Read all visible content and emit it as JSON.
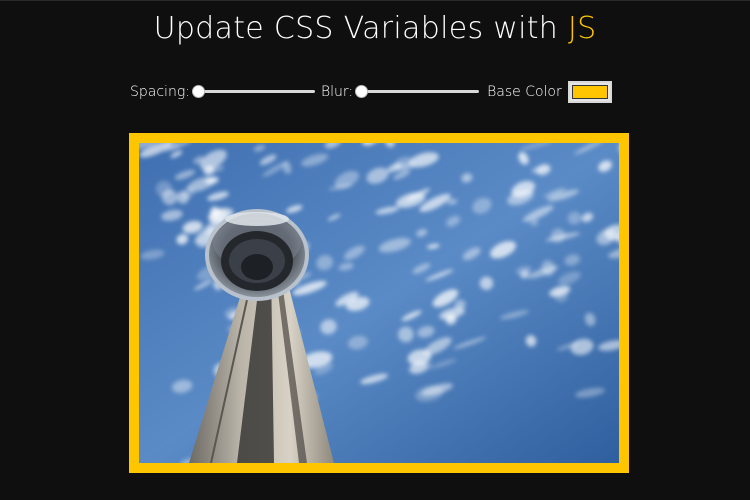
{
  "header": {
    "title_prefix": "Update CSS Variables with ",
    "title_highlight": "JS"
  },
  "controls": {
    "spacing_label": "Spacing:",
    "spacing_value": 0,
    "blur_label": "Blur:",
    "blur_value": 0,
    "base_color_label": "Base Color",
    "base_color_value": "#ffc600"
  },
  "colors": {
    "background": "#0f0f0f",
    "accent": "#ffc600",
    "text": "#ffffff"
  },
  "image": {
    "subject": "low-angle view of a tall concrete observation tower against a blue sky with scattered white clouds"
  }
}
